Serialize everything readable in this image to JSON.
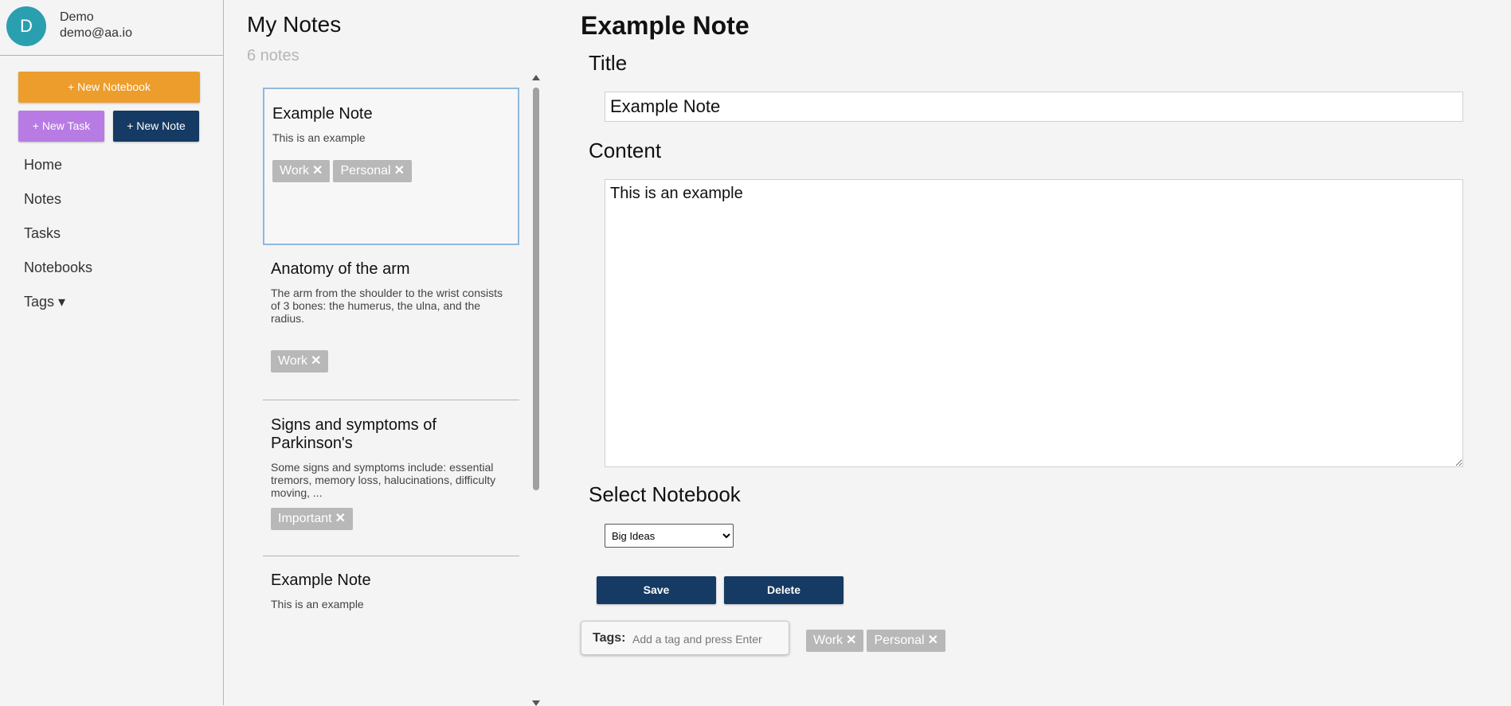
{
  "user": {
    "initial": "D",
    "name": "Demo",
    "email": "demo@aa.io",
    "avatar_color": "#2a9fb0"
  },
  "sidebar": {
    "new_notebook": "+ New Notebook",
    "new_task": "+ New Task",
    "new_note": "+ New Note",
    "nav": [
      "Home",
      "Notes",
      "Tasks",
      "Notebooks",
      "Tags ▾"
    ]
  },
  "list": {
    "title": "My Notes",
    "count": "6 notes",
    "notes": [
      {
        "title": "Example Note",
        "excerpt": "This is an example",
        "tags": [
          "Work",
          "Personal"
        ]
      },
      {
        "title": "Anatomy of the arm",
        "excerpt": "The arm from the shoulder to the wrist consists of 3 bones: the humerus, the ulna, and the radius.",
        "tags": [
          "Work"
        ]
      },
      {
        "title": "Signs and symptoms of Parkinson's",
        "excerpt": "Some signs and symptoms include: essential tremors, memory loss, halucinations, difficulty moving, ...",
        "tags": [
          "Important"
        ]
      },
      {
        "title": "Example Note",
        "excerpt": "This is an example",
        "tags": []
      }
    ],
    "tag_remove": "✕"
  },
  "editor": {
    "heading": "Example Note",
    "title_label": "Title",
    "title_value": "Example Note",
    "content_label": "Content",
    "content_value": "This is an example",
    "notebook_label": "Select Notebook",
    "notebook_value": "Big Ideas",
    "save_label": "Save",
    "delete_label": "Delete",
    "tags_label": "Tags:",
    "tags_placeholder": "Add a tag and press Enter",
    "tags": [
      "Work",
      "Personal"
    ]
  },
  "colors": {
    "orange": "#ec9d2c",
    "purple": "#b77be3",
    "navy": "#153a63",
    "tag_gray": "#b8b8b8"
  }
}
